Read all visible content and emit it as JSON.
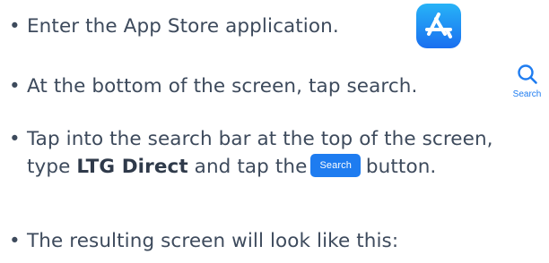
{
  "steps": [
    {
      "text": "Enter the App Store application."
    },
    {
      "text": "At the bottom of the screen, tap search."
    },
    {
      "text_before": "Tap into the search bar at the top of the screen, type ",
      "bold": "LTG Direct",
      "text_middle": " and tap the",
      "text_after": "button."
    },
    {
      "text": "The resulting screen will look like this:"
    }
  ],
  "bullet": "•",
  "icons": {
    "app_store": "app-store-icon",
    "search_tab": "magnifying-glass-icon"
  },
  "search_tab_label": "Search",
  "search_button_label": "Search",
  "colors": {
    "text": "#3d4a5c",
    "accent_blue": "#1e7cf0",
    "app_store_gradient_top": "#27b3f7",
    "app_store_gradient_bottom": "#1a6ff0"
  }
}
